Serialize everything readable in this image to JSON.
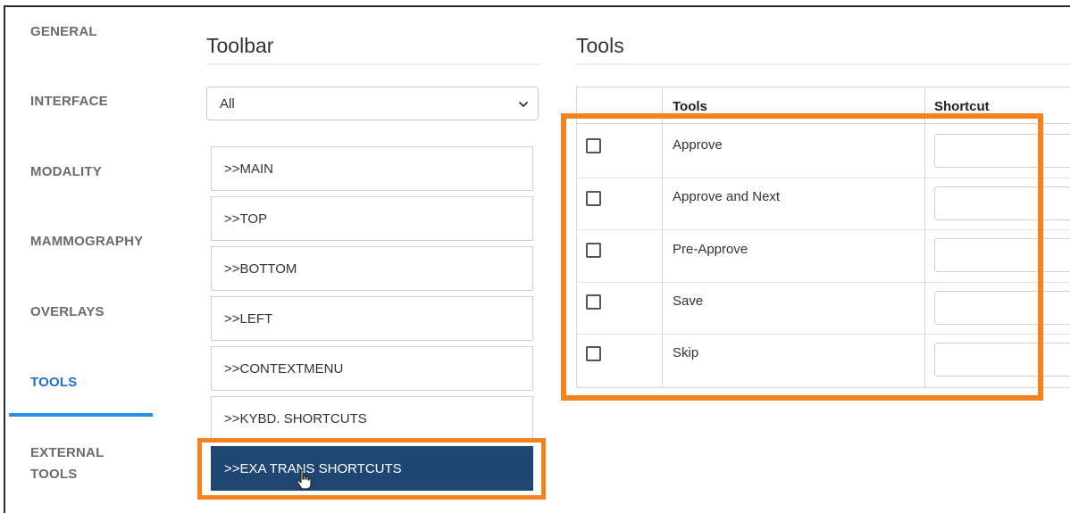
{
  "nav": {
    "items": [
      {
        "label": "GENERAL"
      },
      {
        "label": "INTERFACE"
      },
      {
        "label": "MODALITY"
      },
      {
        "label": "MAMMOGRAPHY"
      },
      {
        "label": "OVERLAYS"
      },
      {
        "label": "TOOLS",
        "active": true
      },
      {
        "label_line1": "EXTERNAL",
        "label_line2": "TOOLS"
      }
    ],
    "active_color": "#1f6fd6"
  },
  "toolbar": {
    "title": "Toolbar",
    "filter": {
      "selected": "All"
    },
    "items": [
      {
        "label": ">>MAIN"
      },
      {
        "label": ">>TOP"
      },
      {
        "label": ">>BOTTOM"
      },
      {
        "label": ">>LEFT"
      },
      {
        "label": ">>CONTEXTMENU"
      },
      {
        "label": ">>KYBD. SHORTCUTS"
      },
      {
        "label": ">>EXA TRANS SHORTCUTS",
        "selected": true
      }
    ],
    "selected_color": "#1f4673"
  },
  "tools": {
    "title": "Tools",
    "columns": [
      "",
      "Tools",
      "Shortcut"
    ],
    "rows": [
      {
        "name": "Approve",
        "checked": false,
        "shortcut": ""
      },
      {
        "name": "Approve and Next",
        "checked": false,
        "shortcut": ""
      },
      {
        "name": "Pre-Approve",
        "checked": false,
        "shortcut": ""
      },
      {
        "name": "Save",
        "checked": false,
        "shortcut": ""
      },
      {
        "name": "Skip",
        "checked": false,
        "shortcut": ""
      }
    ]
  },
  "highlight_color": "#f58220"
}
